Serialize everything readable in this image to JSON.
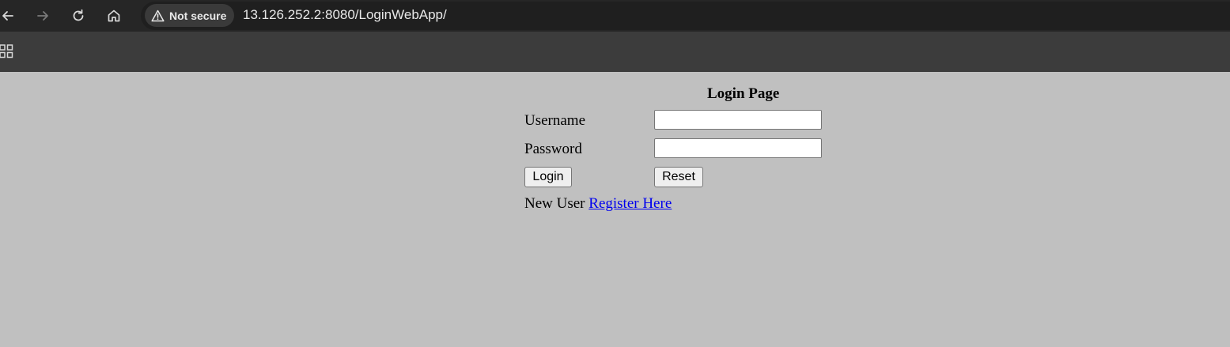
{
  "browser": {
    "security_label": "Not secure",
    "url": "13.126.252.2:8080/LoginWebApp/",
    "icons": [
      "back-arrow-icon",
      "forward-arrow-icon",
      "reload-icon",
      "home-icon",
      "warning-triangle-icon",
      "apps-grid-icon"
    ]
  },
  "page": {
    "title": "Login Page",
    "username_label": "Username",
    "username_value": "",
    "password_label": "Password",
    "password_value": "",
    "login_button": "Login",
    "reset_button": "Reset",
    "new_user_text": "New User",
    "register_link": "Register Here",
    "colors": {
      "background": "#c0c0c0",
      "link": "#0000ee"
    }
  }
}
